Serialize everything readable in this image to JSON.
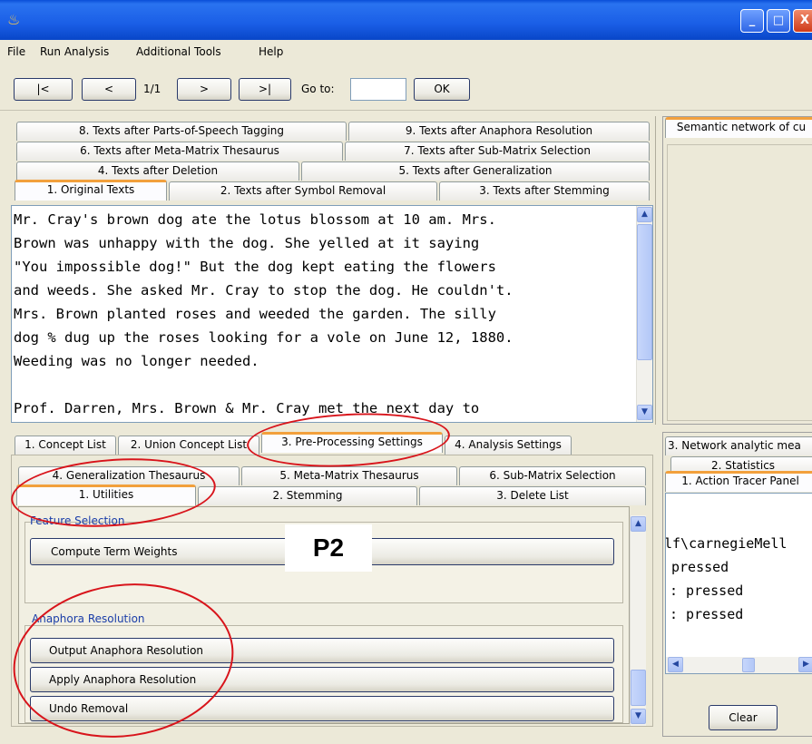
{
  "window": {
    "close_glyph": "X",
    "min_glyph": "_",
    "max_glyph": "□",
    "app_icon": "java-cup-icon"
  },
  "menu": [
    "File",
    "Run Analysis",
    "Additional Tools",
    "Help"
  ],
  "nav": {
    "first": "|<",
    "prev": "<",
    "page": "1/1",
    "next": ">",
    "last": ">|",
    "goto_label": "Go to:",
    "goto_value": "",
    "ok": "OK"
  },
  "text_tabs": {
    "row1": [
      "8. Texts after Parts-of-Speech Tagging",
      "9. Texts after Anaphora Resolution"
    ],
    "row2": [
      "6. Texts after Meta-Matrix Thesaurus",
      "7. Texts after Sub-Matrix Selection"
    ],
    "row3": [
      "4. Texts after Deletion",
      "5. Texts after Generalization"
    ],
    "row4": [
      "1. Original Texts",
      "2. Texts after Symbol Removal",
      "3. Texts after Stemming"
    ]
  },
  "original_text": [
    "Mr. Cray's brown dog ate the lotus blossom at 10 am. Mrs.",
    "Brown was unhappy with the dog. She yelled at it saying",
    "\"You impossible dog!\" But the dog kept eating the flowers",
    "and weeds. She asked Mr. Cray to stop the dog. He couldn't.",
    "Mrs. Brown planted roses and weeded the garden. The silly",
    "dog % dug up the roses looking for a vole on June 12, 1880.",
    "Weeding was no longer needed.",
    "",
    "Prof. Darren, Mrs. Brown & Mr. Cray met the next day to"
  ],
  "right_top": {
    "tab": "Semantic network of cu"
  },
  "bottom_tabs": [
    "1. Concept List",
    "2. Union Concept List",
    "3. Pre-Processing Settings",
    "4. Analysis Settings"
  ],
  "settings_tabs": {
    "row1": [
      "4. Generalization Thesaurus",
      "5. Meta-Matrix Thesaurus",
      "6. Sub-Matrix Selection"
    ],
    "row2": [
      "1. Utilities",
      "2. Stemming",
      "3. Delete List"
    ]
  },
  "feature_selection": {
    "label": "Feature Selection",
    "compute_button": "Compute Term Weights"
  },
  "anaphora": {
    "label": "Anaphora Resolution",
    "buttons": [
      "Output Anaphora Resolution",
      "Apply Anaphora Resolution",
      "Undo Removal"
    ]
  },
  "annotation": "P2",
  "right_bottom": {
    "tabs": [
      "3. Network analytic mea",
      "2. Statistics",
      "1. Action Tracer Panel"
    ],
    "lines": [
      "lf\\carnegieMell",
      "pressed",
      ": pressed",
      ": pressed"
    ],
    "clear": "Clear"
  },
  "colors": {
    "title_blue": "#0a4fd8",
    "tab_orange": "#f2a03c",
    "annotation_red": "#d8141b",
    "group_blue": "#1a3da8"
  }
}
